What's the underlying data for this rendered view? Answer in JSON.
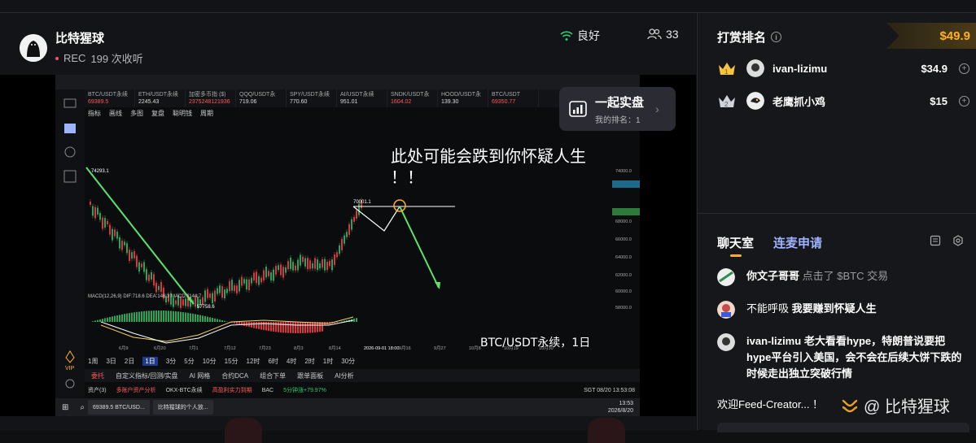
{
  "host": {
    "name": "比特猩球",
    "rec": "REC",
    "listeners": "199 次收听"
  },
  "network": {
    "status": "良好"
  },
  "audience": {
    "count": "33"
  },
  "live_card": {
    "title": "一起实盘",
    "subtitle": "我的排名：1"
  },
  "screen": {
    "tickers": [
      {
        "name": "BTC/USDT永续",
        "value": "69389.5",
        "color": "r"
      },
      {
        "name": "ETH/USDT永续",
        "value": "2245.43",
        "color": ""
      },
      {
        "name": "加密多币指 ($)",
        "value": "2375248121936",
        "color": "r"
      },
      {
        "name": "QQQ/USDT永",
        "value": "719.06",
        "color": ""
      },
      {
        "name": "SPY/USDT永续",
        "value": "770.60",
        "color": ""
      },
      {
        "name": "AI/USDT永续",
        "value": "951.01",
        "color": ""
      },
      {
        "name": "SNDK/USDT永",
        "value": "1604.02",
        "color": "r"
      },
      {
        "name": "HOOD/USDT永",
        "value": "139.30",
        "color": ""
      },
      {
        "name": "BTC/USDT",
        "value": "69350.77",
        "color": "r"
      }
    ],
    "subbar": [
      "指标",
      "画线",
      "多图",
      "复盘",
      "聪明钱",
      "周期"
    ],
    "timeframes": [
      "1周",
      "3日",
      "2日",
      "1日",
      "3分",
      "5分",
      "10分",
      "15分",
      "12时",
      "6时",
      "4时",
      "2时",
      "1时",
      "30分"
    ],
    "active_timeframe": "1日",
    "bottom_tabs": [
      "委托",
      "自定义指标/回测/实盘",
      "AI 网格",
      "合约DCA",
      "组合下单",
      "跟单面板",
      "AI分析"
    ],
    "status": [
      "资产(3)",
      "多账户资产分析",
      "OKX-BTC永续",
      "高盈利实力到期",
      "BAC",
      "5分钟涨+79.97%",
      "SGT 08/20 13:53:08"
    ],
    "taskbar": {
      "item1": "69389.5 BTC/USD...",
      "item2": "比特猩球的个人放...",
      "time": "13:53",
      "date": "2026/8/20"
    },
    "annotation": "此处可能会跌到你怀疑人生",
    "annotation2": "！！",
    "pair_label": "BTC/USDT永续，1日",
    "price_high": "74293.1",
    "price_low": "57758.6",
    "price_mark": "70001.1",
    "macd_label": "MACD(12,26,9)  DIF:718.6  DEA:146.3  MACD:1144.7",
    "y_labels": [
      "74000.0",
      "72804.5",
      "69389.5",
      "68000.0",
      "66000.0",
      "64000.0",
      "62000.0",
      "60000.0",
      "58000.0"
    ],
    "x_labels": [
      "6月9",
      "6月20",
      "7月1",
      "7月12",
      "7月23",
      "8月3",
      "8月14",
      "2026-09-01 18:00",
      "9月16",
      "9月27",
      "10月8",
      "10月19",
      "10月30"
    ]
  },
  "ranking": {
    "title": "打赏排名",
    "total": "$49.9",
    "items": [
      {
        "rank": "1",
        "name": "ivan-lizimu",
        "amount": "$34.9"
      },
      {
        "rank": "2",
        "name": "老鹰抓小鸡",
        "amount": "$15"
      }
    ]
  },
  "chat": {
    "tab_chat": "聊天室",
    "tab_mic": "连麦申请",
    "messages": [
      {
        "user": "你文子哥哥",
        "text": "点击了 $BTC 交易"
      },
      {
        "user": "不能呼吸",
        "text": "我要赚到怀疑人生"
      },
      {
        "user": "ivan-lizimu",
        "text": "老大看看hype，特朗普说要把hype平台引入美国，会不会在后续大饼下跌的时候走出独立突破行情"
      }
    ],
    "welcome": "欢迎Feed-Creator...  ！",
    "watermark": "@ 比特猩球"
  },
  "colors": {
    "accent": "#ffb020",
    "up": "#2ecc71",
    "down": "#ff4d4d",
    "link": "#9fb4ff"
  }
}
